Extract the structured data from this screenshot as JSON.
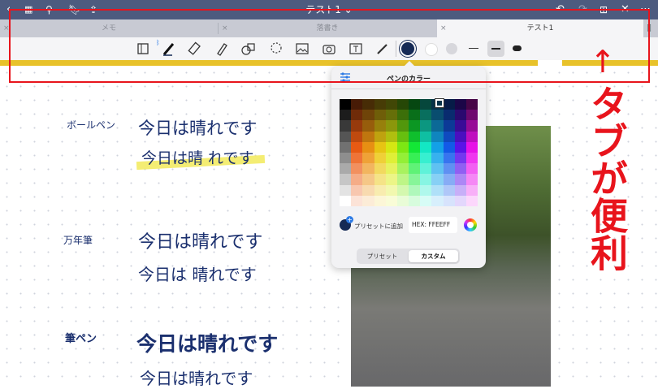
{
  "topbar": {
    "title": "テスト1 ⌄",
    "icons": [
      "back-chevron-icon",
      "grid-icon",
      "search-icon",
      "bookmark-icon",
      "share-icon",
      "undo-icon",
      "redo-icon",
      "add-page-icon",
      "close-icon",
      "more-icon"
    ]
  },
  "tabs": [
    {
      "label": "メモ",
      "active": false
    },
    {
      "label": "落書き",
      "active": false
    },
    {
      "label": "テスト1",
      "active": true
    }
  ],
  "toolbar": {
    "tools": [
      "page-view-icon",
      "pen-icon",
      "eraser-icon",
      "highlighter-icon",
      "shapes-icon",
      "lasso-icon",
      "image-icon",
      "camera-icon",
      "text-icon",
      "laser-icon"
    ],
    "colors": [
      "#152a55",
      "#ffffff",
      "#d7d7dc"
    ],
    "selected_color": "#152a55"
  },
  "popover": {
    "title": "ペンのカラー",
    "add_preset_label": "プリセットに追加",
    "hex_label": "HEX: FFEEFF",
    "segments": [
      "プリセット",
      "カスタム"
    ],
    "active_segment": "カスタム"
  },
  "handwriting": {
    "rows": [
      {
        "label": "ボールペン",
        "text1": "今日は晴れです",
        "text2": "今日は晴 れです"
      },
      {
        "label": "万年筆",
        "text1": "今日は晴れです",
        "text2": "今日は 晴れです"
      },
      {
        "label": "筆ペン",
        "text1": "今日は晴れです",
        "text2": "今日は晴れです"
      }
    ]
  },
  "annotation": {
    "arrow": "↑",
    "text": "タブが便利",
    "color": "#e8141c"
  },
  "colors": {
    "topbar": "#4d5b7f",
    "highlight": "#e8c22a",
    "ink": "#1a2f6e"
  }
}
